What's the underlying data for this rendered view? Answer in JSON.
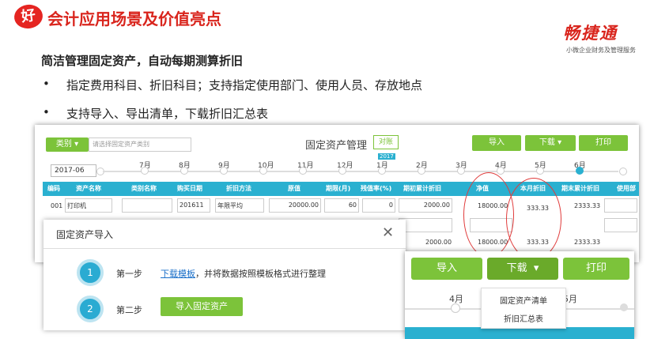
{
  "header": {
    "badge": "好",
    "title": "会计应用场景及价值亮点",
    "logo": "畅捷通",
    "logo_sub": "小微企业财务及管理服务"
  },
  "intro": {
    "subhead": "简洁管理固定资产，自动每期测算折旧",
    "bullets": [
      {
        "dot": "•",
        "text": "指定费用科目、折旧科目；支持指定使用部门、使用人员、存放地点"
      },
      {
        "dot": "•",
        "text": "支持导入、导出清单，下载折旧汇总表"
      }
    ]
  },
  "app": {
    "category_label": "类别",
    "category_placeholder": "请选择固定资产类别",
    "title": "固定资产管理",
    "compare": "对账",
    "import": "导入",
    "download": "下载",
    "print": "打印",
    "date": "2017-06",
    "year_tag": "2017",
    "months": [
      "7月",
      "8月",
      "9月",
      "10月",
      "11月",
      "12月",
      "1月",
      "2月",
      "3月",
      "4月",
      "5月",
      "6月"
    ],
    "columns": [
      "编码",
      "资产名称",
      "类别名称",
      "购买日期",
      "折旧方法",
      "原值",
      "期限(月)",
      "残值率(%)",
      "期初累计折旧",
      "净值",
      "本月折旧",
      "期末累计折旧",
      "使用部"
    ],
    "row1": {
      "code": "001",
      "name": "打印机",
      "category": "",
      "date": "201611",
      "method": "年限平均",
      "original": "20000.00",
      "term": "60",
      "residual": "0",
      "opening": "2000.00",
      "net": "18000.00",
      "monthly": "333.33",
      "closing": "2333.33"
    },
    "row_total": {
      "opening": "2000.00",
      "net": "18000.00",
      "monthly": "333.33",
      "closing": "2333.33"
    }
  },
  "dialog": {
    "title": "固定资产导入",
    "close": "✕",
    "step1": {
      "num": "1",
      "label": "第一步",
      "link": "下载模板",
      "rest": "，并将数据按照模板格式进行整理"
    },
    "step2": {
      "num": "2",
      "label": "第二步",
      "button": "导入固定资产"
    }
  },
  "zoom": {
    "import": "导入",
    "download": "下载",
    "print": "打印",
    "months": [
      "4月",
      "5月"
    ],
    "menu": [
      "固定资产清单",
      "折旧汇总表"
    ]
  },
  "colors": {
    "accent": "#7cc33a",
    "header_blue": "#2ab0d0",
    "brand_red": "#d9251d",
    "annotation": "#e03b3b"
  }
}
